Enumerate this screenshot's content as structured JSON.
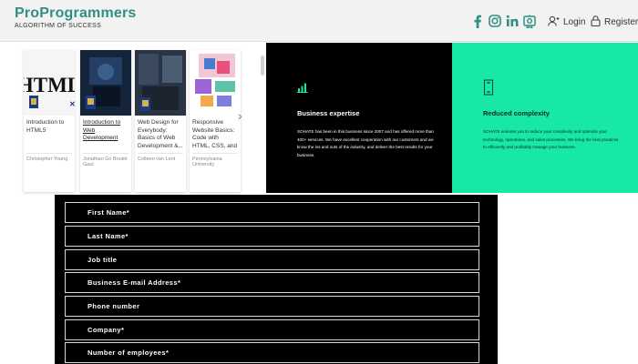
{
  "header": {
    "brand_name": "ProProgrammers",
    "brand_tagline": "ALGORITHM OF SUCCESS",
    "social_icons": [
      "facebook-icon",
      "instagram-icon",
      "linkedin-icon",
      "certificate-icon"
    ],
    "login_label": "Login",
    "register_label": "Register",
    "accent_color": "#2f8f83"
  },
  "courses": [
    {
      "title": "Introduction to HTML5",
      "author": "Christopher Young",
      "thumb_text": "HTML"
    },
    {
      "title": "Introduction to Web Development",
      "author": "Jonathan Go Boulet Gaul",
      "thumb_text": ""
    },
    {
      "title": "Web Design for Everybody: Basics of Web Development &...",
      "author": "Colleen van Lent",
      "thumb_text": ""
    },
    {
      "title": "Responsive Website Basics: Code with HTML, CSS, and JavaS...",
      "author": "Pennsylvania University",
      "thumb_text": ""
    }
  ],
  "features": [
    {
      "icon": "bar-chart-icon",
      "title": "Business expertise",
      "text": "SOHATE has been in this business since 2007 and has offered more than 400+ services. We have excellent cooperation with our customers and we know the ins and outs of the industry, and deliver the best results for your business."
    },
    {
      "icon": "reduced-complexity-icon",
      "title": "Reduced complexity",
      "text": "SOHATE ensures you to reduce your complexity and optimize your technology, operations, and sales processes. We bring the best practices to efficiently and profitably manage your business."
    }
  ],
  "form": {
    "fields": [
      "First Name*",
      "Last Name*",
      "Job title",
      "Business E-mail Address*",
      "Phone number",
      "Company*",
      "Number of employees*"
    ]
  }
}
